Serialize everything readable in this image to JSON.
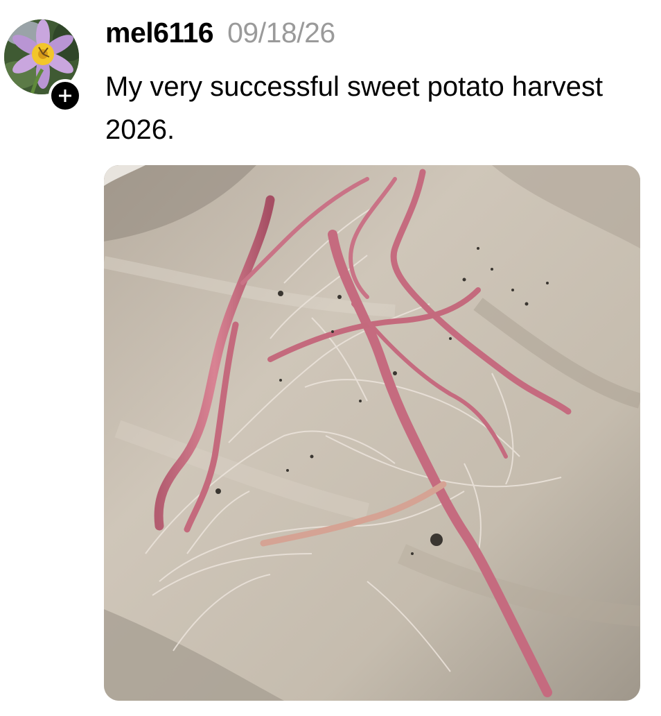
{
  "post": {
    "author": {
      "username": "mel6116",
      "avatar_icon": "flower-avatar-icon",
      "follow_icon": "plus-icon"
    },
    "timestamp": "09/18/26",
    "text": "My very successful sweet potato harvest 2026.",
    "media": {
      "type": "photo",
      "colors": {
        "paper": "#c8bfb2",
        "root": "#c26a7d",
        "soil": "#3a3631"
      }
    }
  }
}
